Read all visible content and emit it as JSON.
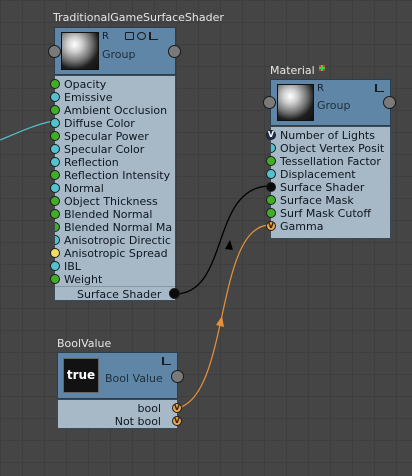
{
  "nodes": {
    "shader": {
      "title": "TraditionalGameSurfaceShader",
      "header_letter": "R",
      "header_label": "Group",
      "inputs": [
        {
          "label": "Opacity",
          "port_color": "#3fae24"
        },
        {
          "label": "Emissive",
          "port_color": "#52c2cf"
        },
        {
          "label": "Ambient Occlusion",
          "port_color": "#3fae24"
        },
        {
          "label": "Diffuse Color",
          "port_color": "#52c2cf"
        },
        {
          "label": "Specular Power",
          "port_color": "#3fae24"
        },
        {
          "label": "Specular Color",
          "port_color": "#52c2cf"
        },
        {
          "label": "Reflection",
          "port_color": "#52c2cf"
        },
        {
          "label": "Reflection Intensity",
          "port_color": "#3fae24"
        },
        {
          "label": "Normal",
          "port_color": "#52c2cf"
        },
        {
          "label": "Object Thickness",
          "port_color": "#3fae24"
        },
        {
          "label": "Blended Normal",
          "port_color": "#3fae24"
        },
        {
          "label": "Blended Normal Ma",
          "port_color": "#3fae24"
        },
        {
          "label": "Anisotropic Directic",
          "port_color": "#52c2cf"
        },
        {
          "label": "Anisotropic Spread",
          "port_color": "#f0dc5e"
        },
        {
          "label": "IBL",
          "port_color": "#52c2cf"
        },
        {
          "label": "Weight",
          "port_color": "#3fae24"
        }
      ],
      "output": {
        "label": "Surface Shader",
        "port_color": "#0a0a0a"
      }
    },
    "material": {
      "title": "Material",
      "header_letter": "R",
      "header_label": "Group",
      "inputs": [
        {
          "label": "Number of Lights",
          "port_color": "#1b2f5a",
          "tag": "V"
        },
        {
          "label": "Object Vertex Posit",
          "port_color": "#52c2cf"
        },
        {
          "label": "Tessellation Factor",
          "port_color": "#3fae24"
        },
        {
          "label": "Displacement",
          "port_color": "#52c2cf"
        },
        {
          "label": "Surface Shader",
          "port_color": "#0a0a0a"
        },
        {
          "label": "Surface Mask",
          "port_color": "#3fae24"
        },
        {
          "label": "Surf Mask Cutoff",
          "port_color": "#3fae24"
        },
        {
          "label": "Gamma",
          "port_color": "#e8a550",
          "tag": "V"
        }
      ]
    },
    "boolvalue": {
      "title": "BoolValue",
      "thumbnail_text": "true",
      "header_label": "Bool Value",
      "outputs": [
        {
          "label": "bool",
          "port_color": "#e8a550",
          "tag": "V"
        },
        {
          "label": "Not bool",
          "port_color": "#e8a550",
          "tag": "V"
        }
      ]
    }
  },
  "connections": [
    {
      "from": "shader.Surface Shader",
      "to": "material.Surface Shader",
      "color": "#000000"
    },
    {
      "from": "boolvalue.bool",
      "to": "material.Gamma",
      "color": "#e8913a"
    },
    {
      "from": "offscreen",
      "to": "shader.Diffuse Color",
      "color": "#52c2cf"
    }
  ],
  "icons": [
    "lock-icon",
    "target-icon",
    "pin-icon",
    "gizmo-icon"
  ]
}
